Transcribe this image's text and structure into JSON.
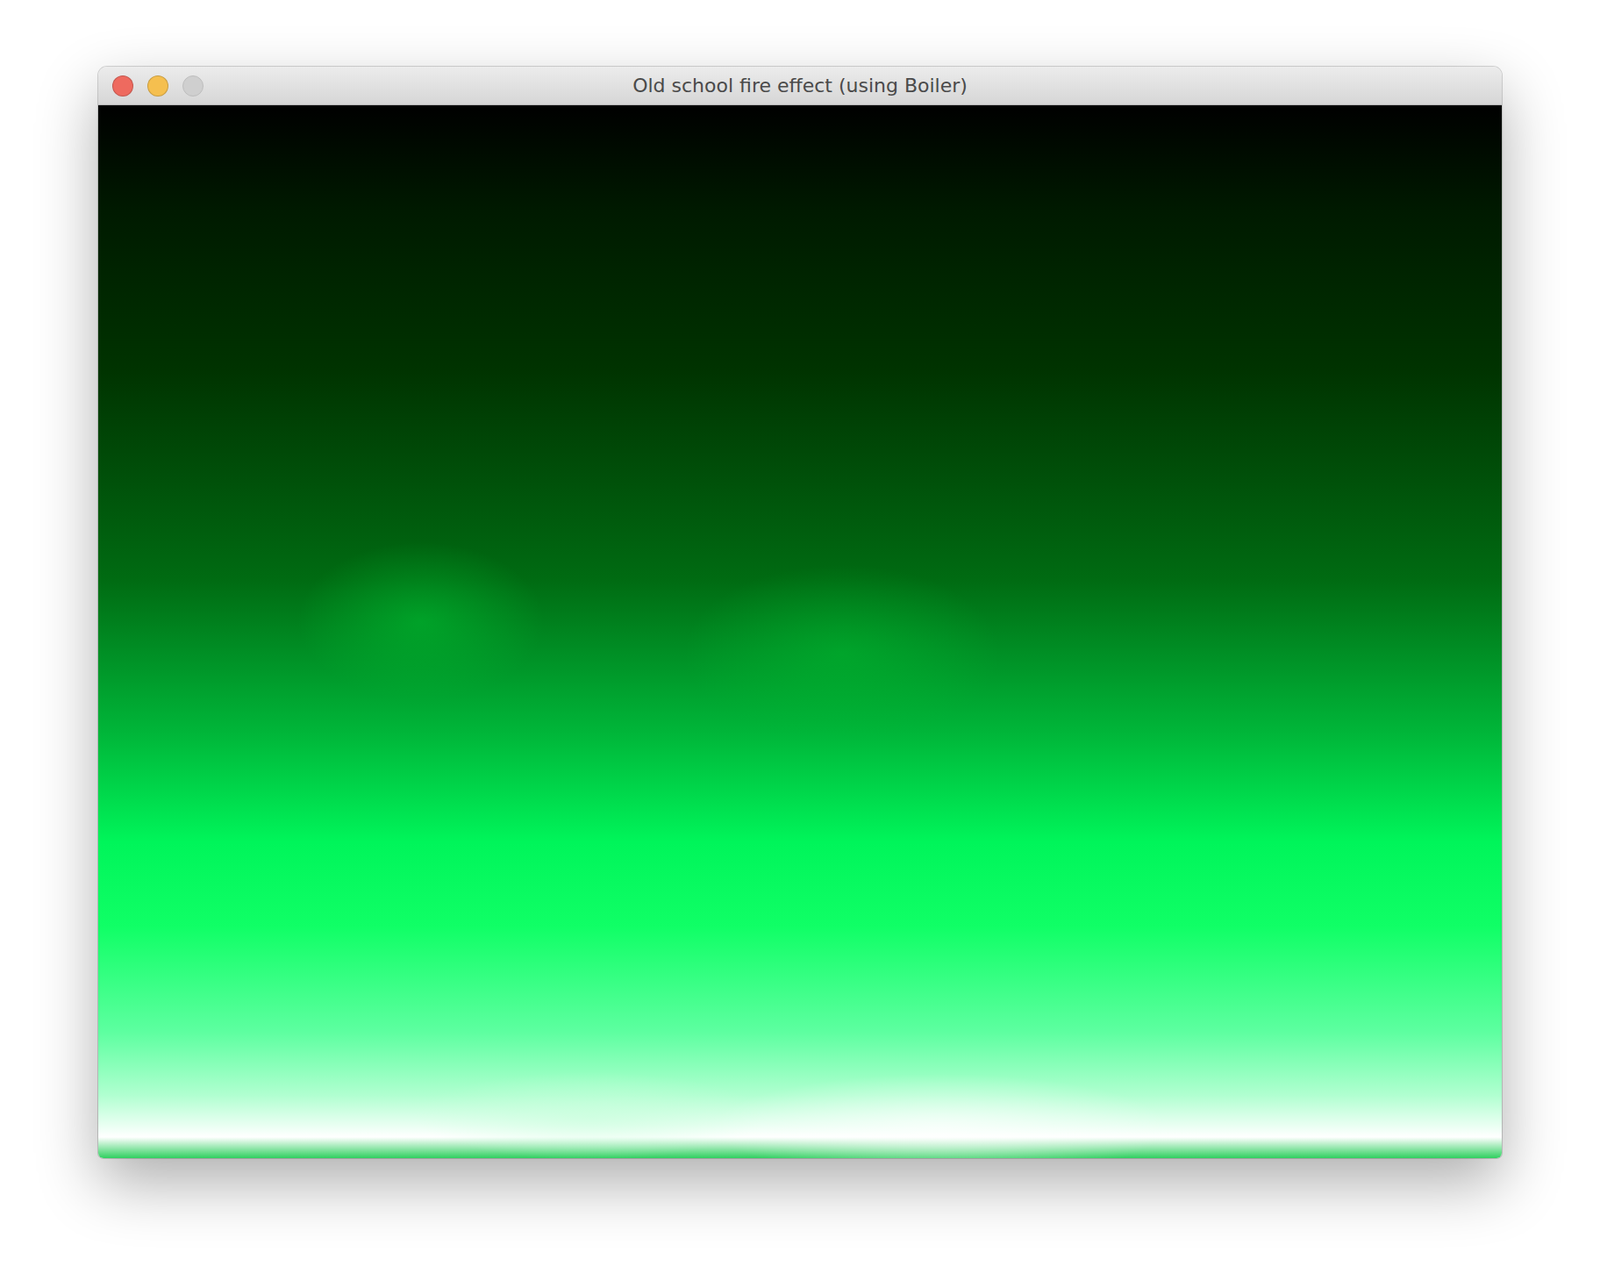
{
  "window": {
    "title": "Old school fire effect (using Boiler)"
  },
  "window_controls": [
    {
      "name": "close",
      "disabled": false,
      "color": "#ee6a5f"
    },
    {
      "name": "minimize",
      "disabled": false,
      "color": "#f5bf4f"
    },
    {
      "name": "zoom",
      "disabled": true,
      "color": "#cfcfcf"
    }
  ]
}
